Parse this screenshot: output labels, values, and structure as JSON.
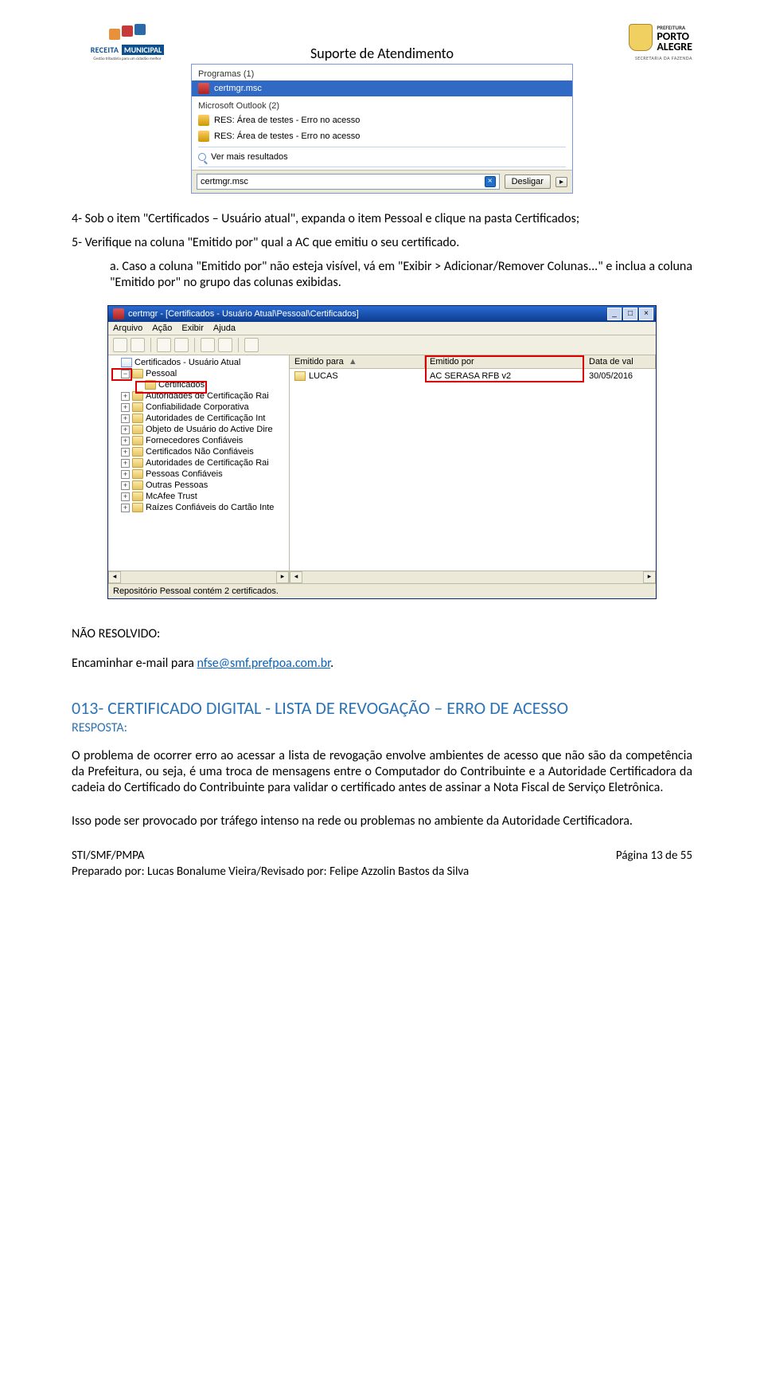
{
  "header": {
    "left": {
      "line1": "RECEITA",
      "line2": "MUNICIPAL",
      "tagline": "Gestão tributária para um cidadão melhor"
    },
    "title": "Suporte de Atendimento",
    "right": {
      "pref": "PREFEITURA",
      "city1": "PORTO",
      "city2": "ALEGRE",
      "sec": "SECRETARIA DA FAZENDA"
    }
  },
  "startmenu": {
    "programs_label": "Programas (1)",
    "program_item": "certmgr.msc",
    "outlook_label": "Microsoft Outlook (2)",
    "outlook_item1": "RES: Área de testes - Erro no acesso",
    "outlook_item2": "RES: Área de testes - Erro no acesso",
    "see_more": "Ver mais resultados",
    "search_value": "certmgr.msc",
    "shutdown": "Desligar"
  },
  "text": {
    "p1": "4- Sob o item \"Certificados – Usuário atual\", expanda o item Pessoal e clique na pasta Certificados;",
    "p2": "5- Verifique na coluna \"Emitido por\" qual a AC que emitiu o seu certificado.",
    "p3": "a. Caso a coluna \"Emitido por\" não esteja visível, vá em \"Exibir > Adicionar/Remover Colunas...\" e inclua a coluna \"Emitido por\" no grupo das colunas exibidas.",
    "nao_resolvido": "NÃO RESOLVIDO:",
    "encaminhar": "Encaminhar e-mail para ",
    "email": "nfse@smf.prefpoa.com.br",
    "section_title": "013- CERTIFICADO DIGITAL - LISTA DE REVOGAÇÃO – ERRO DE ACESSO",
    "resposta": "RESPOSTA:",
    "p4": "O problema de ocorrer erro ao acessar a lista de revogação envolve ambientes de acesso que não são da competência da Prefeitura, ou seja, é uma troca de mensagens entre o Computador do Contribuinte e a Autoridade Certificadora da cadeia do Certificado do Contribuinte para validar o certificado antes de assinar a Nota Fiscal de Serviço Eletrônica.",
    "p5": "Isso pode ser provocado por tráfego intenso na rede ou problemas no ambiente da Autoridade Certificadora."
  },
  "certmgr": {
    "title": "certmgr - [Certificados - Usuário Atual\\Pessoal\\Certificados]",
    "menu": {
      "arquivo": "Arquivo",
      "acao": "Ação",
      "exibir": "Exibir",
      "ajuda": "Ajuda"
    },
    "tree": {
      "root": "Certificados - Usuário Atual",
      "pessoal": "Pessoal",
      "certificados": "Certificados",
      "items": [
        "Autoridades de Certificação Rai",
        "Confiabilidade Corporativa",
        "Autoridades de Certificação Int",
        "Objeto de Usuário do Active Dire",
        "Fornecedores Confiáveis",
        "Certificados Não Confiáveis",
        "Autoridades de Certificação Rai",
        "Pessoas Confiáveis",
        "Outras Pessoas",
        "McAfee Trust",
        "Raízes Confiáveis do Cartão Inte"
      ]
    },
    "cols": {
      "c1": "Emitido para",
      "c1sort": "▲",
      "c2": "Emitido por",
      "c3": "Data de val"
    },
    "row": {
      "name": "LUCAS",
      "issuer": "AC SERASA RFB v2",
      "date": "30/05/2016"
    },
    "status": "Repositório Pessoal contém 2 certificados."
  },
  "footer": {
    "left": "STI/SMF/PMPA",
    "right": "Página 13 de 55",
    "author": "Preparado por: Lucas Bonalume Vieira/Revisado por: Felipe Azzolin Bastos da Silva"
  }
}
